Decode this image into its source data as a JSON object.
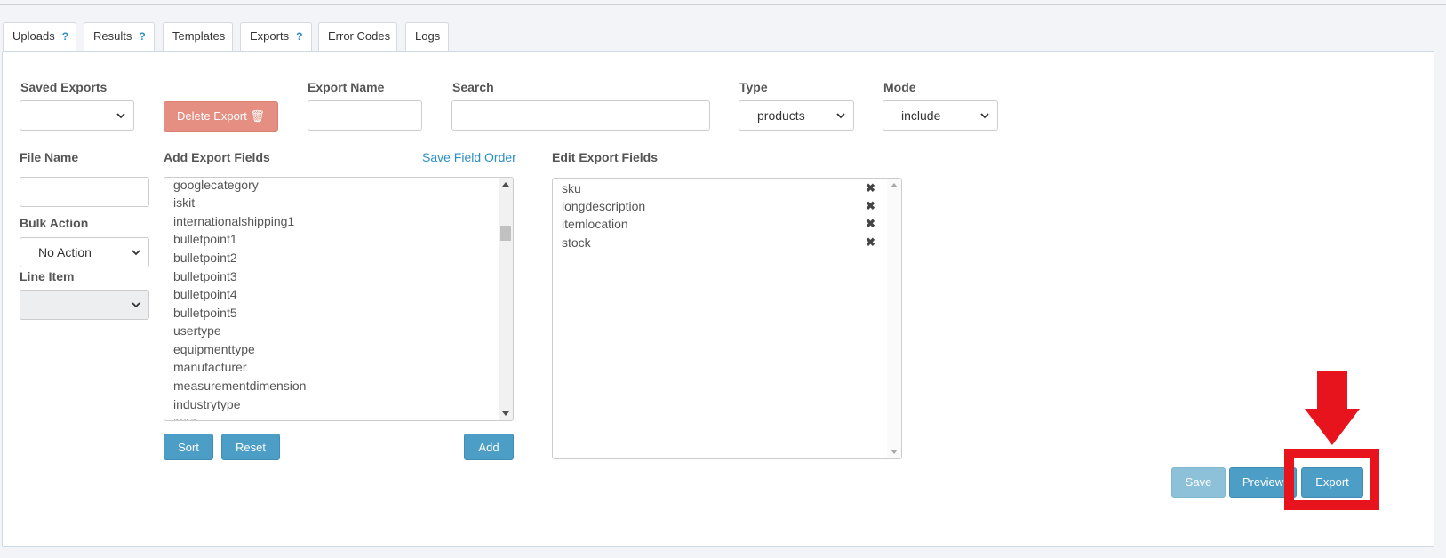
{
  "tabs": [
    {
      "label": "Uploads",
      "help": "?"
    },
    {
      "label": "Results",
      "help": "?"
    },
    {
      "label": "Templates"
    },
    {
      "label": "Exports",
      "help": "?"
    },
    {
      "label": "Error Codes"
    },
    {
      "label": "Logs"
    }
  ],
  "form": {
    "saved_exports_label": "Saved Exports",
    "saved_exports_value": "",
    "delete_export_label": "Delete Export 🗑",
    "export_name_label": "Export Name",
    "export_name_value": "",
    "search_label": "Search",
    "search_value": "",
    "type_label": "Type",
    "type_value": "products",
    "mode_label": "Mode",
    "mode_value": "include",
    "file_name_label": "File Name",
    "file_name_value": "",
    "bulk_action_label": "Bulk Action",
    "bulk_action_value": "No Action",
    "line_item_label": "Line Item",
    "line_item_value": ""
  },
  "add_fields": {
    "label": "Add Export Fields",
    "save_order_link": "Save Field Order",
    "items": [
      "googlecategory",
      "iskit",
      "internationalshipping1",
      "bulletpoint1",
      "bulletpoint2",
      "bulletpoint3",
      "bulletpoint4",
      "bulletpoint5",
      "usertype",
      "equipmenttype",
      "manufacturer",
      "measurementdimension",
      "industrytype",
      "mpn"
    ],
    "sort_label": "Sort",
    "reset_label": "Reset",
    "add_label": "Add"
  },
  "edit_fields": {
    "label": "Edit Export Fields",
    "items": [
      "sku",
      "longdescription",
      "itemlocation",
      "stock"
    ],
    "remove_glyph": "✖"
  },
  "actions": {
    "save_label": "Save",
    "preview_label": "Preview",
    "export_label": "Export"
  },
  "colors": {
    "primary_button": "#4d9ec6",
    "danger_button": "#e58f82",
    "link": "#2d8fc4",
    "annotation": "#e8141d"
  },
  "icons": {
    "dropdown": "chevron-down-icon",
    "delete": "trash-icon",
    "remove_field": "close-icon",
    "annotation_arrow": "arrow-down-icon"
  }
}
